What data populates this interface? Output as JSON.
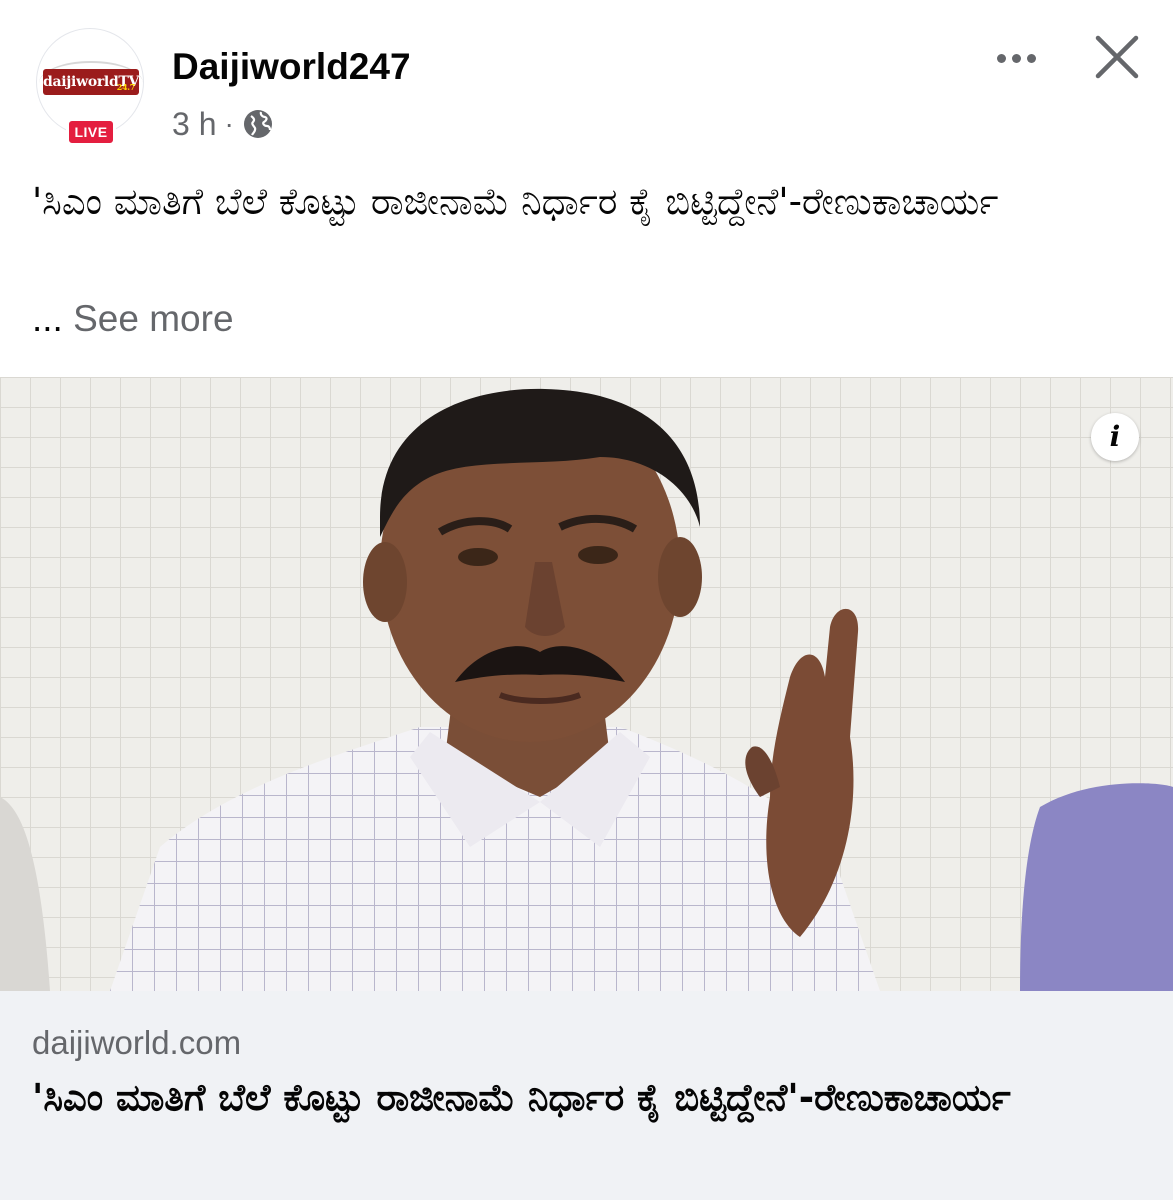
{
  "post": {
    "page_name": "Daijiworld247",
    "timestamp": "3 h",
    "separator": "·",
    "audience_icon": "globe-icon",
    "live_badge": "LIVE",
    "logo_text": "daijiworldTV",
    "logo_sub": "24.7",
    "text": "'ಸಿಎಂ ಮಾತಿಗೆ ಬೆಲೆ ಕೊಟ್ಟು ರಾಜೀನಾಮೆ ನಿರ್ಧಾರ ಕೈ ಬಿಟ್ಟಿದ್ದೇನೆ'-ರೇಣುಕಾಚಾರ್ಯ",
    "see_more_ellipsis": "...",
    "see_more_label": "See more"
  },
  "header_actions": {
    "more_icon": "more-horizontal-icon",
    "close_icon": "close-icon"
  },
  "media": {
    "info_icon_label": "i"
  },
  "link_preview": {
    "domain": "daijiworld.com",
    "title": "'ಸಿಎಂ ಮಾತಿಗೆ ಬೆಲೆ ಕೊಟ್ಟು ರಾಜೀನಾಮೆ ನಿರ್ಧಾರ ಕೈ ಬಿಟ್ಟಿದ್ದೇನೆ'-ರೇಣುಕಾಚಾರ್ಯ"
  },
  "colors": {
    "live_red": "#e41e3f",
    "secondary_text": "#65676b",
    "card_background": "#f0f2f5",
    "logo_red": "#9b1c1c"
  }
}
